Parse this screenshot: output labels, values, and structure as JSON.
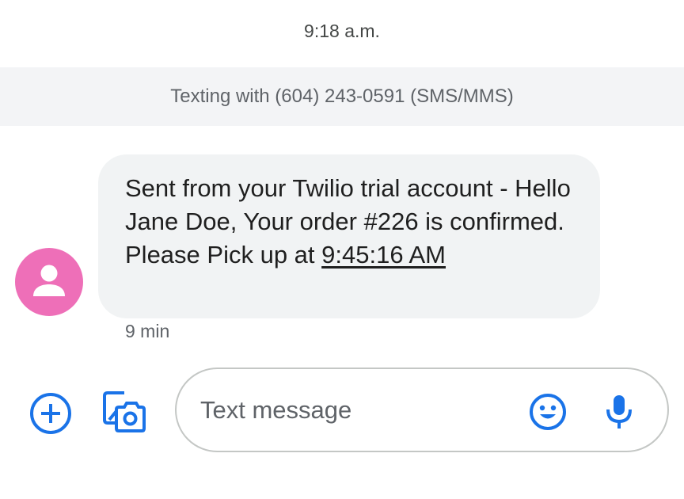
{
  "header": {
    "time": "9:18 a.m."
  },
  "conversation": {
    "banner": "Texting with (604) 243-0591 (SMS/MMS)"
  },
  "message": {
    "text": "Sent from your Twilio trial account - Hello Jane Doe, Your order #226 is confirmed. Please Pick up at ",
    "link_text": "9:45:16 AM",
    "age": "9 min"
  },
  "compose": {
    "placeholder": "Text message"
  },
  "icons": {
    "add": "add-circle-icon",
    "gallery": "gallery-camera-icon",
    "emoji": "emoji-icon",
    "mic": "microphone-icon",
    "avatar": "person-icon"
  },
  "colors": {
    "accent": "#1a73e8",
    "avatar": "#ee6fb8",
    "bubble": "#f1f3f4",
    "banner": "#f3f4f6"
  }
}
